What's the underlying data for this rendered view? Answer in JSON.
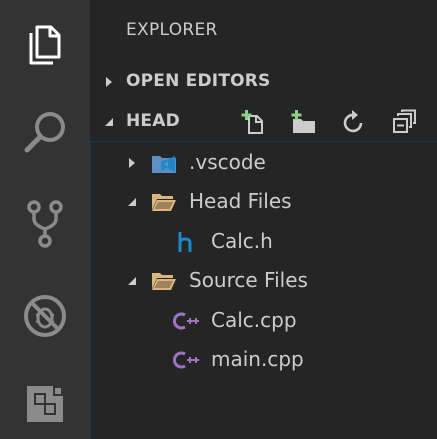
{
  "activity_bar": {
    "items": [
      {
        "id": "explorer",
        "icon": "files-icon"
      },
      {
        "id": "search",
        "icon": "search-icon"
      },
      {
        "id": "scm",
        "icon": "source-control-icon"
      },
      {
        "id": "debug",
        "icon": "debug-icon"
      },
      {
        "id": "extensions",
        "icon": "extensions-icon"
      }
    ]
  },
  "sidebar": {
    "title": "EXPLORER",
    "open_editors": {
      "label": "OPEN EDITORS",
      "expanded": false
    },
    "workspace": {
      "label": "HEAD",
      "expanded": true,
      "actions": [
        "new-file-icon",
        "new-folder-icon",
        "refresh-icon",
        "collapse-all-icon"
      ]
    },
    "tree": [
      {
        "label": ".vscode",
        "kind": "folder-vscode",
        "expanded": false,
        "depth": 0
      },
      {
        "label": "Head Files",
        "kind": "folder",
        "expanded": true,
        "depth": 0
      },
      {
        "label": "Calc.h",
        "kind": "h-file",
        "depth": 1
      },
      {
        "label": "Source Files",
        "kind": "folder",
        "expanded": true,
        "depth": 0
      },
      {
        "label": "Calc.cpp",
        "kind": "cpp-file",
        "depth": 1
      },
      {
        "label": "main.cpp",
        "kind": "cpp-file",
        "depth": 1
      }
    ]
  },
  "colors": {
    "activity_bar_bg": "#333333",
    "sidebar_bg": "#252526",
    "text": "#cccccc",
    "folder": "#dcb67a",
    "h_icon": "#1e88c7",
    "cpp_icon": "#a074c4",
    "add_green": "#89d185",
    "focus_border": "#0e3a5a"
  }
}
